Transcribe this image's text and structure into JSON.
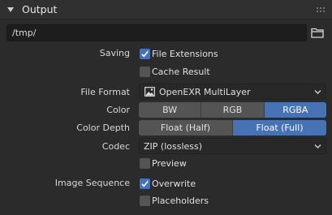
{
  "panel": {
    "title": "Output"
  },
  "path": {
    "value": "/tmp/"
  },
  "saving": {
    "label": "Saving",
    "file_extensions": {
      "label": "File Extensions",
      "checked": true
    },
    "cache_result": {
      "label": "Cache Result",
      "checked": false
    }
  },
  "file_format": {
    "label": "File Format",
    "value": "OpenEXR MultiLayer"
  },
  "color": {
    "label": "Color",
    "options": [
      "BW",
      "RGB",
      "RGBA"
    ],
    "selected": "RGBA"
  },
  "color_depth": {
    "label": "Color Depth",
    "options": [
      "Float (Half)",
      "Float (Full)"
    ],
    "selected": "Float (Full)"
  },
  "codec": {
    "label": "Codec",
    "value": "ZIP (lossless)"
  },
  "preview": {
    "label": "Preview",
    "checked": false
  },
  "image_sequence": {
    "label": "Image Sequence",
    "overwrite": {
      "label": "Overwrite",
      "checked": true
    },
    "placeholders": {
      "label": "Placeholders",
      "checked": false
    }
  },
  "colors": {
    "accent": "#4772b3",
    "background": "#2b2b2b",
    "button": "#545454",
    "field": "#1d1d1d"
  },
  "icons": [
    "disclosure-triangle-icon",
    "drag-grip-icon",
    "folder-icon",
    "checkmark-icon",
    "image-icon",
    "chevron-down-icon"
  ]
}
